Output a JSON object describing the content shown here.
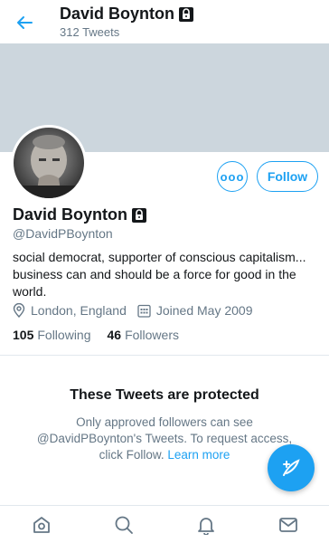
{
  "header": {
    "title": "David Boynton",
    "tweet_count": "312 Tweets"
  },
  "profile": {
    "name": "David Boynton",
    "handle": "@DavidPBoynton",
    "bio": "social democrat, supporter of conscious capitalism... business can and should be a force for good in the world.",
    "location": "London, England",
    "joined": "Joined May 2009",
    "following_count": "105",
    "following_label": "Following",
    "followers_count": "46",
    "followers_label": "Followers",
    "follow_label": "Follow",
    "more_label": "ooo"
  },
  "protected": {
    "title": "These Tweets are protected",
    "text": "Only approved followers can see @DavidPBoynton's Tweets. To request access, click Follow.",
    "link": "Learn more"
  },
  "colors": {
    "accent": "#1da1f2",
    "banner": "#ccd6dd",
    "muted": "#657786"
  },
  "nav": [
    "home-icon",
    "search-icon",
    "notifications-icon",
    "messages-icon"
  ]
}
